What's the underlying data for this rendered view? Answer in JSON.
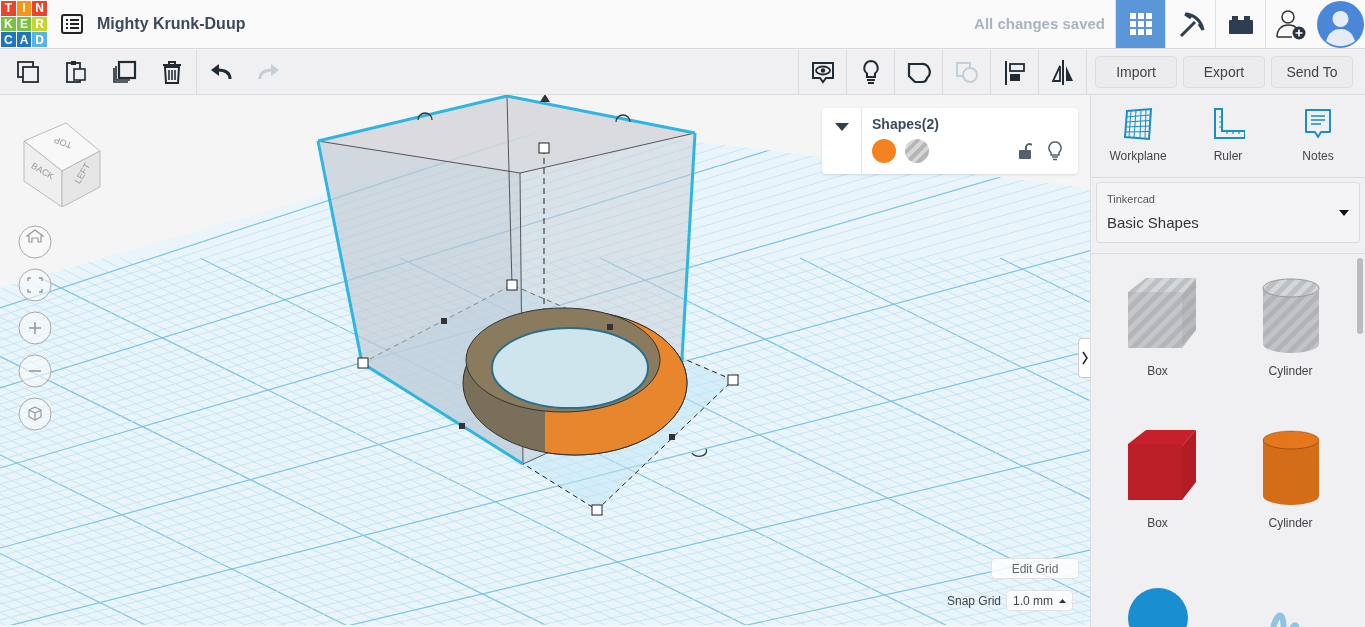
{
  "logo": {
    "letters": [
      {
        "char": "T",
        "color": "#e8452c"
      },
      {
        "char": "I",
        "color": "#f7941d"
      },
      {
        "char": "N",
        "color": "#e8452c"
      },
      {
        "char": "K",
        "color": "#7ac143"
      },
      {
        "char": "E",
        "color": "#7ac143"
      },
      {
        "char": "R",
        "color": "#c5d630"
      },
      {
        "char": "C",
        "color": "#1f75be"
      },
      {
        "char": "A",
        "color": "#1f75be"
      },
      {
        "char": "D",
        "color": "#5bb3e1"
      }
    ]
  },
  "title": "Mighty Krunk-Duup",
  "save_status": "All changes saved",
  "views": [
    {
      "kind": "grid",
      "selected": true
    },
    {
      "kind": "pickaxe",
      "selected": false
    },
    {
      "kind": "bricks",
      "selected": false
    }
  ],
  "edit_tools": [
    {
      "kind": "copy",
      "disabled": false
    },
    {
      "kind": "paste",
      "disabled": false
    },
    {
      "kind": "duplicate",
      "disabled": false
    },
    {
      "kind": "delete",
      "disabled": false
    },
    {
      "kind": "undo",
      "disabled": false
    },
    {
      "kind": "redo",
      "disabled": true
    }
  ],
  "shape_tools": [
    {
      "kind": "notes-view",
      "disabled": false
    },
    {
      "kind": "bulb",
      "disabled": false
    },
    {
      "kind": "group",
      "disabled": false
    },
    {
      "kind": "ungroup",
      "disabled": true
    },
    {
      "kind": "align",
      "disabled": false
    },
    {
      "kind": "mirror",
      "disabled": false
    }
  ],
  "file_buttons": [
    "Import",
    "Export",
    "Send To"
  ],
  "inspector": {
    "title": "Shapes(2)",
    "swatches": [
      {
        "kind": "solid",
        "color": "#f5821f"
      },
      {
        "kind": "hole"
      }
    ],
    "locked": false
  },
  "view_cube": {
    "top": "TOP",
    "back": "BACK",
    "left": "LEFT"
  },
  "nav_controls": [
    {
      "kind": "home"
    },
    {
      "kind": "fit"
    },
    {
      "kind": "zoom-in"
    },
    {
      "kind": "zoom-out"
    },
    {
      "kind": "ortho"
    }
  ],
  "panel_tools": [
    {
      "kind": "workplane",
      "label": "Workplane"
    },
    {
      "kind": "ruler",
      "label": "Ruler"
    },
    {
      "kind": "notes",
      "label": "Notes"
    }
  ],
  "library": {
    "label": "Tinkercad",
    "value": "Basic Shapes"
  },
  "shapes": [
    {
      "kind": "box",
      "hole": true,
      "label": "Box"
    },
    {
      "kind": "cylinder",
      "hole": true,
      "label": "Cylinder"
    },
    {
      "kind": "box",
      "hole": false,
      "color": "#c8202a",
      "label": "Box"
    },
    {
      "kind": "cylinder",
      "hole": false,
      "color": "#e5761b",
      "label": "Cylinder"
    },
    {
      "kind": "sphere",
      "hole": false,
      "color": "#1a8fd0"
    },
    {
      "kind": "scribble",
      "hole": false,
      "color": "#8fc5de"
    }
  ],
  "edit_grid": "Edit Grid",
  "snap_grid": {
    "label": "Snap Grid",
    "value": "1.0 mm"
  }
}
